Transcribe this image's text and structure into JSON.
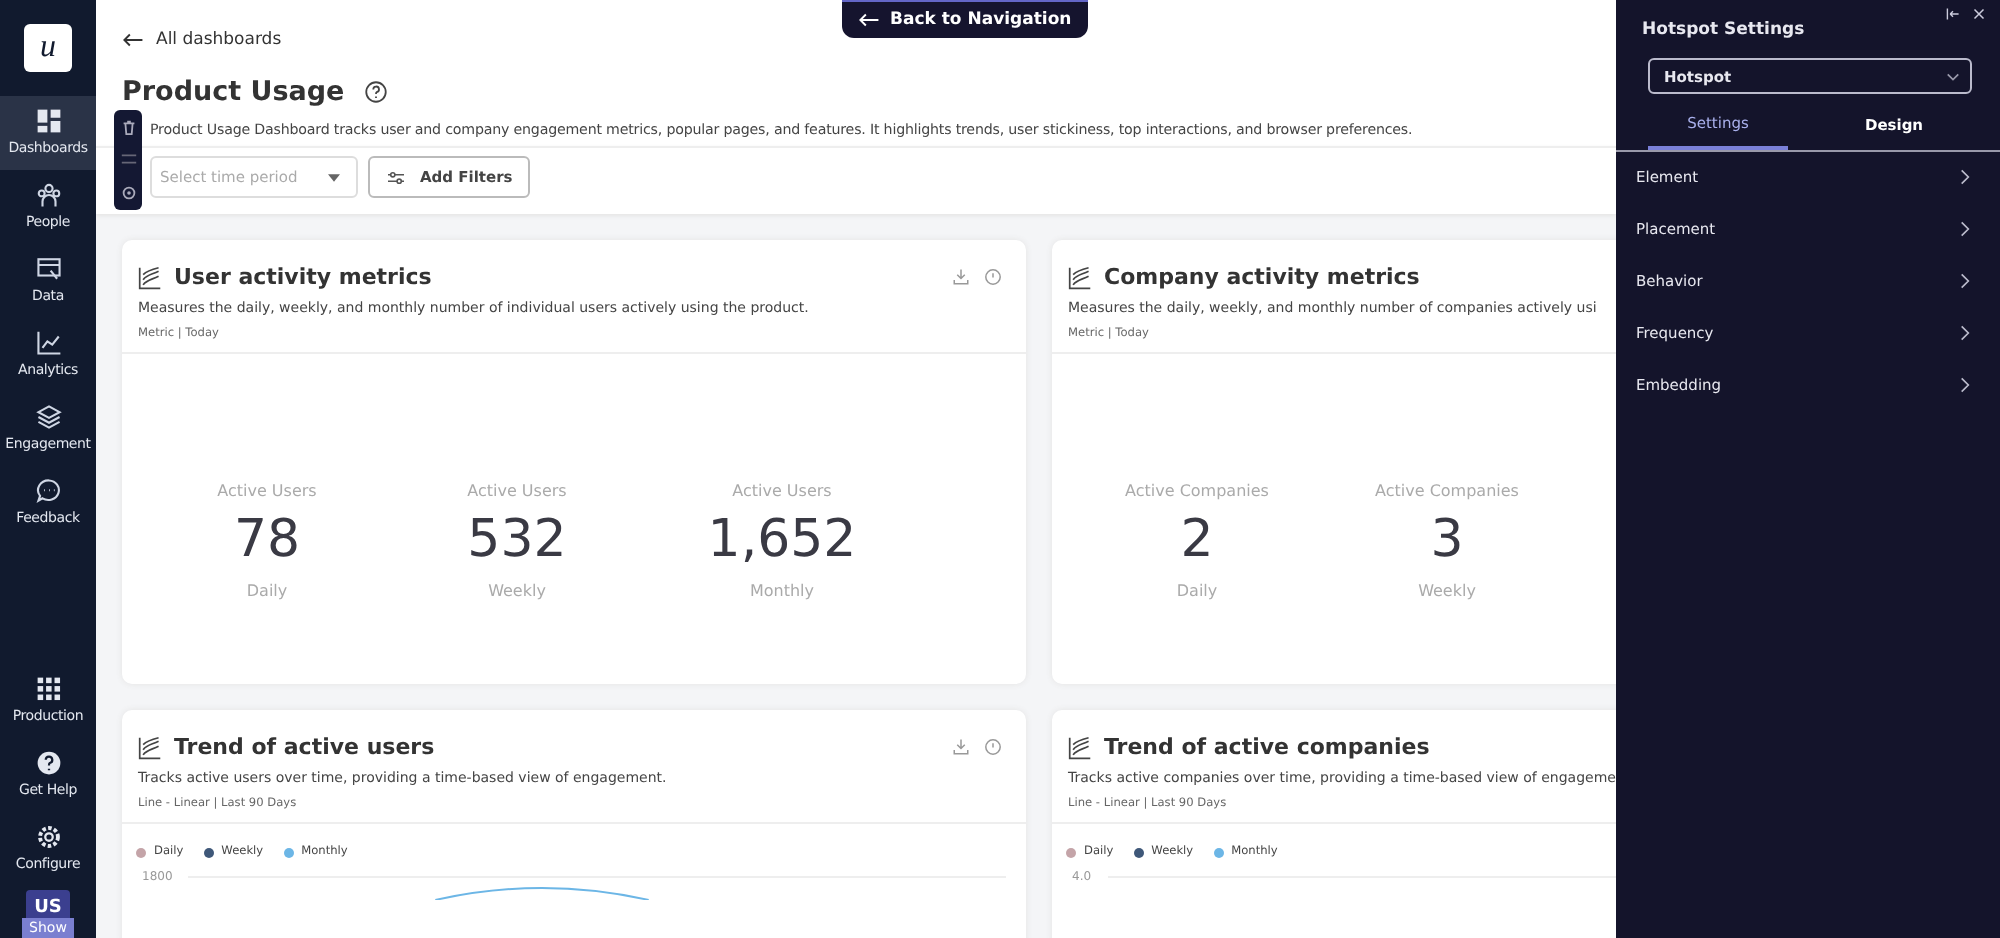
{
  "sidebar": {
    "logo": "u",
    "items": [
      {
        "label": "Dashboards",
        "selected": true
      },
      {
        "label": "People",
        "selected": false
      },
      {
        "label": "Data",
        "selected": false
      },
      {
        "label": "Analytics",
        "selected": false
      },
      {
        "label": "Engagement",
        "selected": false
      },
      {
        "label": "Feedback",
        "selected": false
      }
    ],
    "bottom_items": [
      {
        "label": "Production"
      },
      {
        "label": "Get Help"
      },
      {
        "label": "Configure"
      }
    ],
    "avatar": {
      "initials": "US",
      "label": "Show"
    }
  },
  "back_to_navigation": "Back to Navigation",
  "header": {
    "back_link": "All dashboards",
    "title": "Product Usage",
    "description": "Product Usage Dashboard tracks user and company engagement metrics, popular pages, and features. It highlights trends, user stickiness, top interactions, and browser preferences.",
    "time_period": {
      "placeholder": "Select time period"
    },
    "filters_button": "Add Filters"
  },
  "cards": [
    {
      "kind": "metric",
      "title": "User activity metrics",
      "description": "Measures the daily, weekly, and monthly number of individual users actively using the product.",
      "meta": "Metric | Today",
      "actions": true,
      "metrics": [
        {
          "label": "Active Users",
          "value": "78",
          "period": "Daily"
        },
        {
          "label": "Active Users",
          "value": "532",
          "period": "Weekly"
        },
        {
          "label": "Active Users",
          "value": "1,652",
          "period": "Monthly"
        }
      ]
    },
    {
      "kind": "metric",
      "title": "Company activity metrics",
      "description": "Measures the daily, weekly, and monthly number of companies actively usi",
      "meta": "Metric | Today",
      "metrics": [
        {
          "label": "Active Companies",
          "value": "2",
          "period": "Daily"
        },
        {
          "label": "Active Companies",
          "value": "3",
          "period": "Weekly"
        }
      ]
    },
    {
      "kind": "trend",
      "title": "Trend of active users",
      "description": "Tracks active users over time, providing a time-based view of engagement.",
      "meta": "Line - Linear | Last 90 Days",
      "actions": true,
      "legend": [
        {
          "label": "Daily",
          "color": "#c4a4a8"
        },
        {
          "label": "Weekly",
          "color": "#3f5879"
        },
        {
          "label": "Monthly",
          "color": "#6cb6e6"
        }
      ],
      "top_tick": "1800",
      "curve": true
    },
    {
      "kind": "trend",
      "title": "Trend of active companies",
      "description": "Tracks active companies over time, providing a time-based view of engageme",
      "meta": "Line - Linear | Last 90 Days",
      "legend": [
        {
          "label": "Daily",
          "color": "#c4a4a8"
        },
        {
          "label": "Weekly",
          "color": "#3f5879"
        },
        {
          "label": "Monthly",
          "color": "#6cb6e6"
        }
      ],
      "top_tick": "4.0",
      "curve": false
    }
  ],
  "panel": {
    "title": "Hotspot Settings",
    "select": "Hotspot",
    "tabs": [
      {
        "label": "Settings",
        "selected": true
      },
      {
        "label": "Design",
        "selected": false
      }
    ],
    "items": [
      "Element",
      "Placement",
      "Behavior",
      "Frequency",
      "Embedding"
    ]
  }
}
